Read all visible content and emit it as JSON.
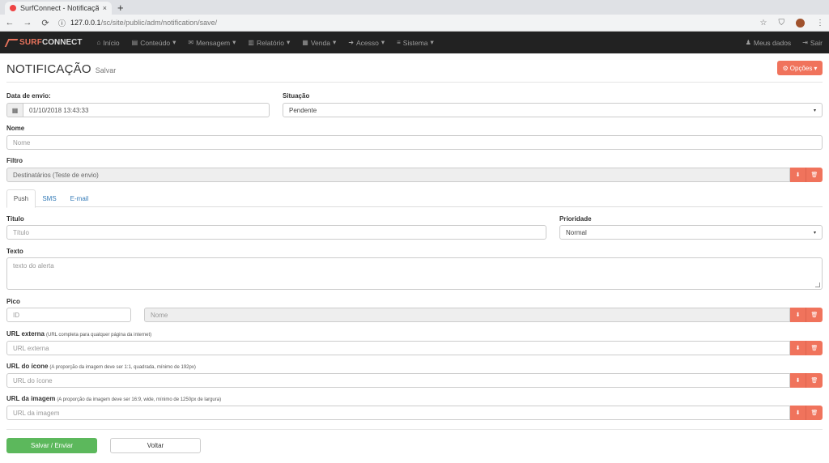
{
  "browser": {
    "tab_title": "SurfConnect - Notificaçã",
    "tab_close": "×",
    "new_tab": "+",
    "url_host": "127.0.0.1",
    "url_path": "/sc/site/public/adm/notification/save/",
    "back": "←",
    "forward": "→",
    "reload": "⟳",
    "info": "ⓘ",
    "star": "☆",
    "shield": "⛉",
    "more": "⋮"
  },
  "navbar": {
    "brand_part1": "SURF",
    "brand_part2": "CONNECT",
    "items": [
      {
        "icon": "⌂",
        "label": "Início",
        "caret": ""
      },
      {
        "icon": "▤",
        "label": "Conteúdo",
        "caret": "▾"
      },
      {
        "icon": "✉",
        "label": "Mensagem",
        "caret": "▾"
      },
      {
        "icon": "▥",
        "label": "Relatório",
        "caret": "▾"
      },
      {
        "icon": "▦",
        "label": "Venda",
        "caret": "▾"
      },
      {
        "icon": "➜",
        "label": "Acesso",
        "caret": "▾"
      },
      {
        "icon": "≡",
        "label": "Sistema",
        "caret": "▾"
      }
    ],
    "right": [
      {
        "icon": "♟",
        "label": "Meus dados"
      },
      {
        "icon": "⇥",
        "label": "Sair"
      }
    ]
  },
  "page": {
    "title": "NOTIFICAÇÃO",
    "subtitle": "Salvar",
    "options_icon": "⚙",
    "options_label": "Opções",
    "options_caret": "▾"
  },
  "form": {
    "data_envio_label": "Data de envio:",
    "data_envio_icon": "▦",
    "data_envio_value": "01/10/2018 13:43:33",
    "situacao_label": "Situação",
    "situacao_value": "Pendente",
    "nome_label": "Nome",
    "nome_placeholder": "Nome",
    "filtro_label": "Filtro",
    "filtro_value": "Destinatários (Teste de envio)",
    "tabs": [
      "Push",
      "SMS",
      "E-mail"
    ],
    "titulo_label": "Título",
    "titulo_placeholder": "Título",
    "prioridade_label": "Prioridade",
    "prioridade_value": "Normal",
    "texto_label": "Texto",
    "texto_placeholder": "texto do alerta",
    "pico_label": "Pico",
    "pico_id_placeholder": "ID",
    "pico_nome_placeholder": "Nome",
    "url_externa_label": "URL externa",
    "url_externa_hint": "(URL completa para qualquer página da internet)",
    "url_externa_placeholder": "URL externa",
    "url_icone_label": "URL do ícone",
    "url_icone_hint": "(A proporção da imagem deve ser 1:1, quadrada, mínimo de 192px)",
    "url_icone_placeholder": "URL do ícone",
    "url_imagem_label": "URL da imagem",
    "url_imagem_hint": "(A proporção da imagem deve ser 16:9, wide, mínimo de 1250px de largura)",
    "url_imagem_placeholder": "URL da imagem",
    "download_icon": "⬇",
    "trash_icon": "🗑",
    "select_caret": "▾",
    "save_label": "Salvar / Enviar",
    "back_label": "Voltar"
  }
}
